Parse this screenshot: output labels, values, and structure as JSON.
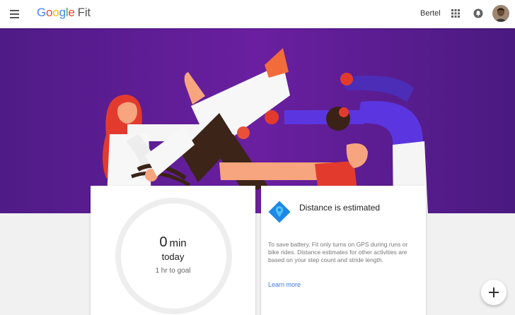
{
  "app": {
    "logo_letters": [
      {
        "char": "G",
        "color": "#4285f4"
      },
      {
        "char": "o",
        "color": "#ea4335"
      },
      {
        "char": "o",
        "color": "#fbbc05"
      },
      {
        "char": "g",
        "color": "#4285f4"
      },
      {
        "char": "l",
        "color": "#34a853"
      },
      {
        "char": "e",
        "color": "#ea4335"
      }
    ],
    "product": "Fit"
  },
  "header": {
    "menu_icon": "hamburger-menu-icon",
    "username": "Bertel",
    "apps_icon": "apps-grid-icon",
    "notifications_icon": "notifications-bell-icon",
    "avatar_icon": "user-avatar"
  },
  "colors": {
    "hero_background": "#5c1f8f",
    "accent_link": "#3b78e7",
    "location_icon": "#1e88e5"
  },
  "goal_card": {
    "value": "0",
    "unit": "min",
    "period": "today",
    "goal": "1 hr to goal",
    "progress_fraction": 0
  },
  "info_card": {
    "icon": "location-pin-icon",
    "title": "Distance is estimated",
    "body": "To save battery, Fit only turns on GPS during runs or bike rides. Distance estimates for other activities are based on your step count and stride length.",
    "link": "Learn more"
  },
  "fab": {
    "icon": "plus-icon"
  }
}
